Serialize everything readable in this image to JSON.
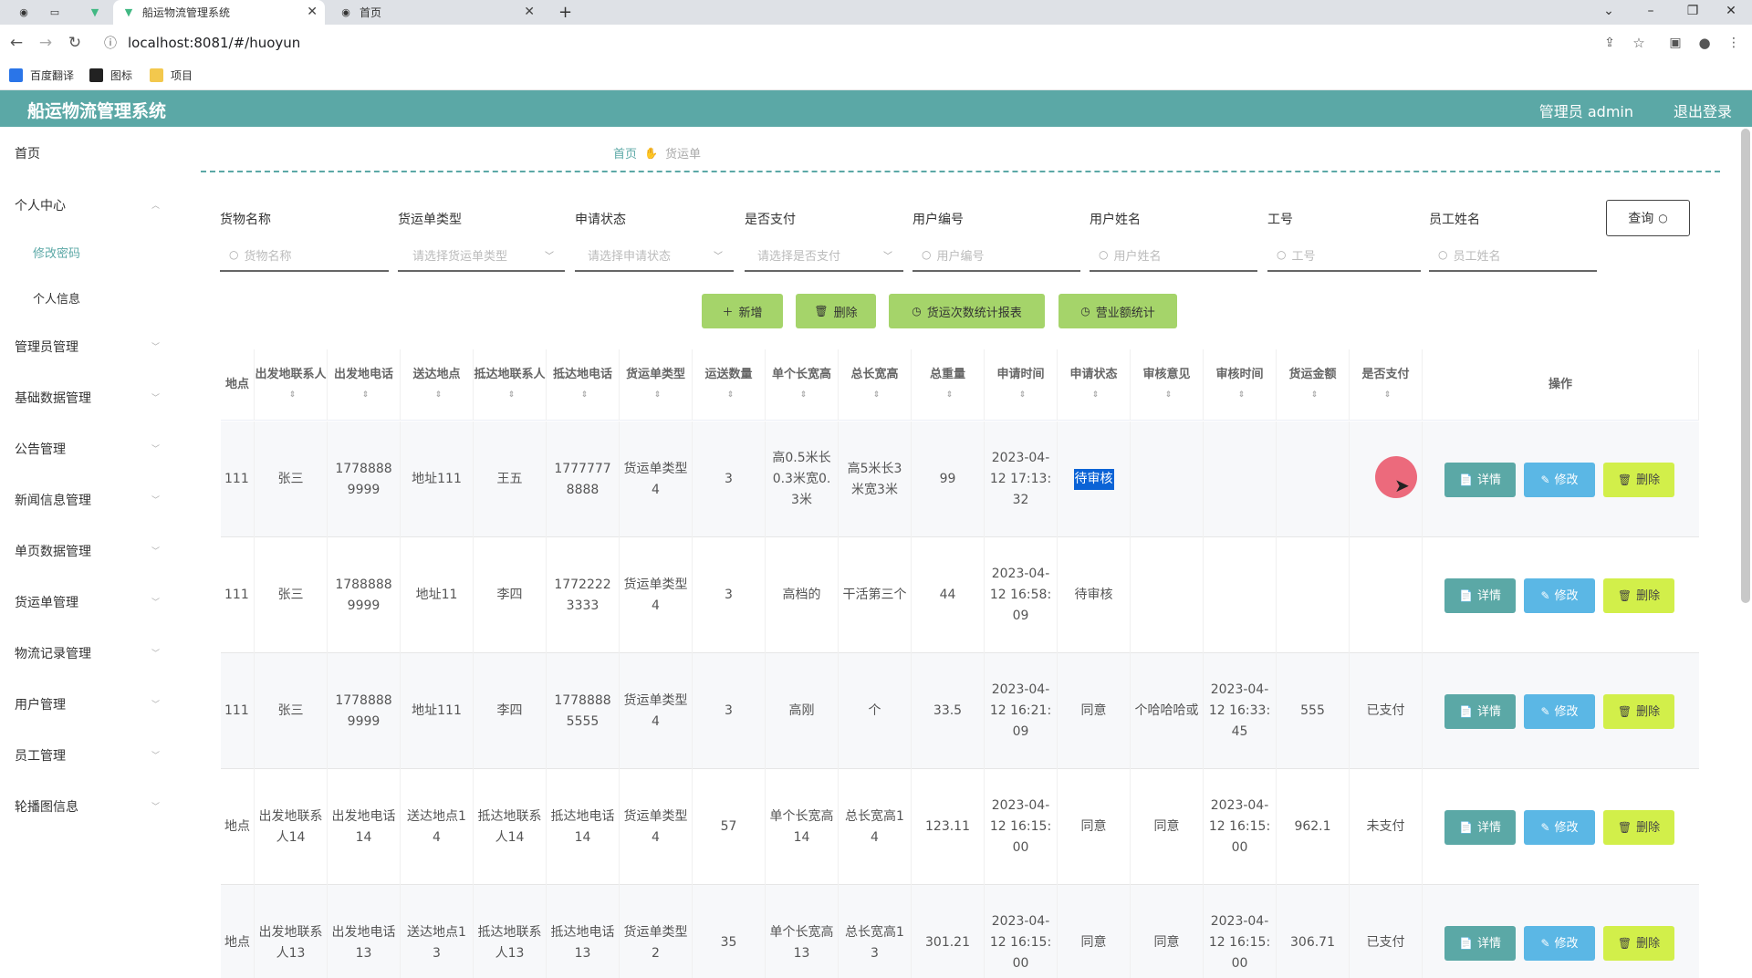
{
  "browser": {
    "tabs": [
      {
        "title": "船运物流管理系统",
        "icon": "vue-logo-icon",
        "active": true
      },
      {
        "title": "首页",
        "icon": "globe-icon",
        "active": false
      }
    ],
    "url": "localhost:8081/#/huoyun",
    "bookmarks": [
      {
        "label": "百度翻译",
        "icon": "translate-icon"
      },
      {
        "label": "图标",
        "icon": "bookmark-black-icon"
      },
      {
        "label": "项目",
        "icon": "folder-icon"
      }
    ]
  },
  "app": {
    "title": "船运物流管理系统",
    "user": "管理员 admin",
    "logout": "退出登录",
    "accent": "#5ba8a6"
  },
  "sidebar": {
    "items": [
      {
        "label": "首页"
      },
      {
        "label": "个人中心"
      },
      {
        "label": "修改密码"
      },
      {
        "label": "个人信息"
      },
      {
        "label": "管理员管理"
      },
      {
        "label": "基础数据管理"
      },
      {
        "label": "公告管理"
      },
      {
        "label": "新闻信息管理"
      },
      {
        "label": "单页数据管理"
      },
      {
        "label": "货运单管理"
      },
      {
        "label": "物流记录管理"
      },
      {
        "label": "用户管理"
      },
      {
        "label": "员工管理"
      },
      {
        "label": "轮播图信息"
      }
    ]
  },
  "breadcrumb": {
    "home": "首页",
    "current": "货运单"
  },
  "search": {
    "fields": [
      {
        "label": "货物名称",
        "placeholder": "货物名称"
      },
      {
        "label": "货运单类型",
        "placeholder": "请选择货运单类型"
      },
      {
        "label": "申请状态",
        "placeholder": "请选择申请状态"
      },
      {
        "label": "是否支付",
        "placeholder": "请选择是否支付"
      },
      {
        "label": "用户编号",
        "placeholder": "用户编号"
      },
      {
        "label": "用户姓名",
        "placeholder": "用户姓名"
      },
      {
        "label": "工号",
        "placeholder": "工号"
      },
      {
        "label": "员工姓名",
        "placeholder": "员工姓名"
      }
    ],
    "query": "查询"
  },
  "actions": {
    "add": "新增",
    "delete": "删除",
    "count_report": "货运次数统计报表",
    "revenue": "营业额统计"
  },
  "table": {
    "headers": [
      "地点",
      "出发地联系人",
      "出发地电话",
      "送达地点",
      "抵达地联系人",
      "抵达地电话",
      "货运单类型",
      "运送数量",
      "单个长宽高",
      "总长宽高",
      "总重量",
      "申请时间",
      "申请状态",
      "审核意见",
      "审核时间",
      "货运金额",
      "是否支付",
      "操作"
    ],
    "row_ops": {
      "detail": "详情",
      "edit": "修改",
      "delete": "删除"
    },
    "rows": [
      [
        "111",
        "张三",
        "17788889999",
        "地址111",
        "王五",
        "17777778888",
        "货运单类型4",
        "3",
        "高0.5米长0.3米宽0.3米",
        "高5米长3米宽3米",
        "99",
        "2023-04-12 17:13:32",
        "待审核",
        "",
        "",
        "",
        ""
      ],
      [
        "111",
        "张三",
        "17888889999",
        "地址11",
        "李四",
        "17722223333",
        "货运单类型4",
        "3",
        "高档的",
        "干活第三个",
        "44",
        "2023-04-12 16:58:09",
        "待审核",
        "",
        "",
        "",
        ""
      ],
      [
        "111",
        "张三",
        "17788889999",
        "地址111",
        "李四",
        "17788885555",
        "货运单类型4",
        "3",
        "高刚",
        "个",
        "33.5",
        "2023-04-12 16:21:09",
        "同意",
        "个哈哈哈或",
        "2023-04-12 16:33:45",
        "555",
        "已支付"
      ],
      [
        "地点",
        "出发地联系人14",
        "出发地电话14",
        "送达地点14",
        "抵达地联系人14",
        "抵达地电话14",
        "货运单类型4",
        "57",
        "单个长宽高14",
        "总长宽高14",
        "123.11",
        "2023-04-12 16:15:00",
        "同意",
        "同意",
        "2023-04-12 16:15:00",
        "962.1",
        "未支付"
      ],
      [
        "地点",
        "出发地联系人13",
        "出发地电话13",
        "送达地点13",
        "抵达地联系人13",
        "抵达地电话13",
        "货运单类型2",
        "35",
        "单个长宽高13",
        "总长宽高13",
        "301.21",
        "2023-04-12 16:15:00",
        "同意",
        "同意",
        "2023-04-12 16:15:00",
        "306.71",
        "已支付"
      ]
    ]
  }
}
